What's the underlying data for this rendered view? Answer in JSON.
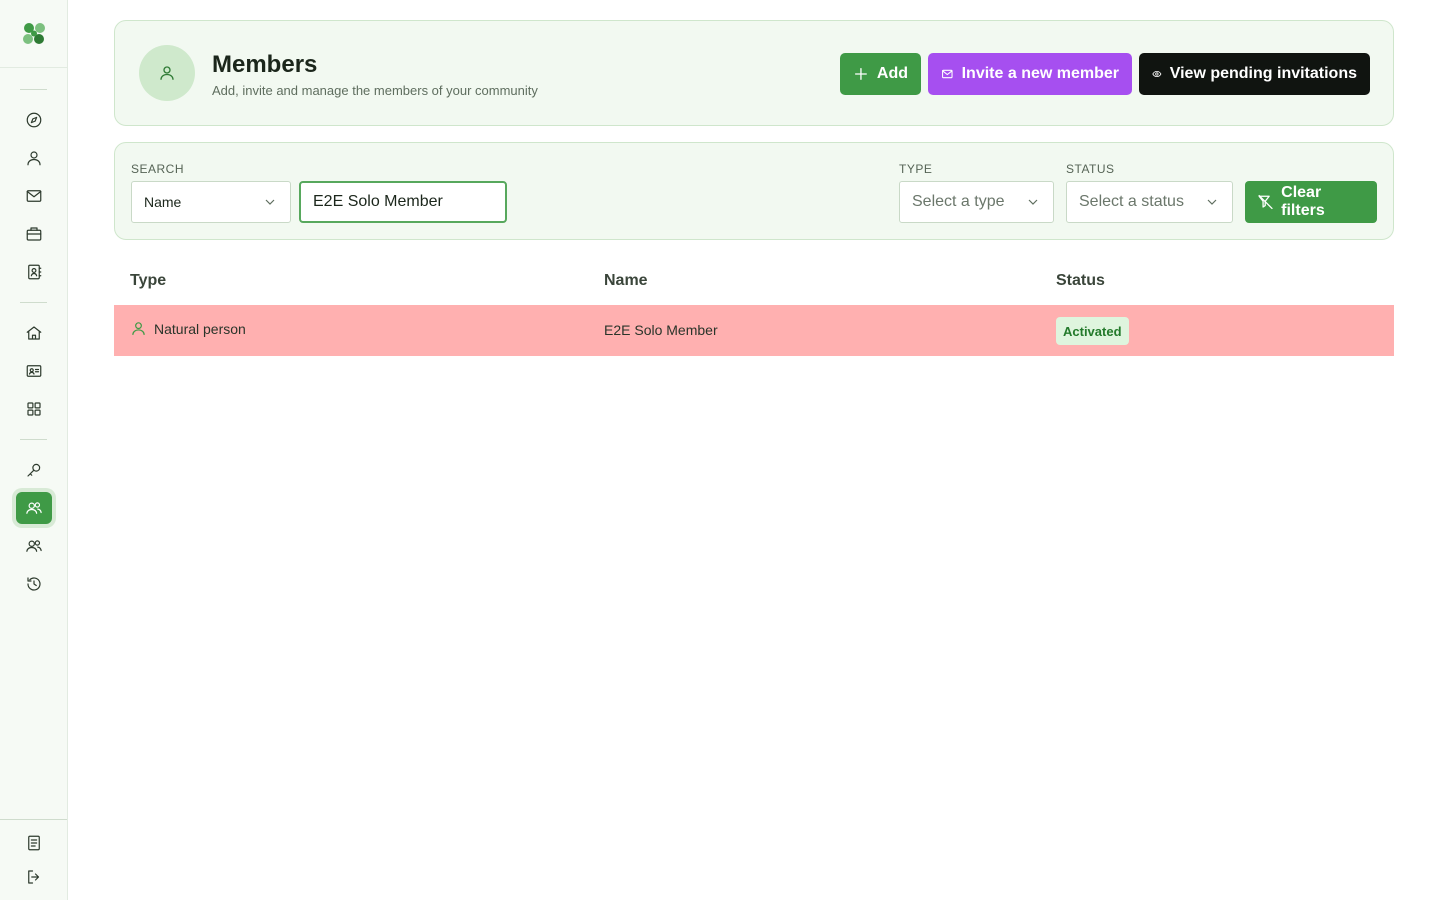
{
  "header": {
    "title": "Members",
    "subtitle": "Add, invite and manage the members of your community",
    "add_label": "Add",
    "invite_label": "Invite a new member",
    "pending_label": "View pending invitations"
  },
  "filters": {
    "search_label": "SEARCH",
    "search_field_selected": "Name",
    "search_value": "E2E Solo Member",
    "type_label": "TYPE",
    "type_placeholder": "Select a type",
    "status_label": "STATUS",
    "status_placeholder": "Select a status",
    "clear_label": "Clear filters"
  },
  "table": {
    "columns": [
      "Type",
      "Name",
      "Status"
    ],
    "rows": [
      {
        "type": "Natural person",
        "name": "E2E Solo Member",
        "status": "Activated"
      }
    ]
  },
  "sidebar": {
    "items": [
      "explore-icon",
      "user-icon",
      "mail-icon",
      "briefcase-icon",
      "contact-book-icon",
      "home-icon",
      "id-card-icon",
      "apps-grid-icon",
      "key-icon",
      "members-icon",
      "group-icon",
      "history-icon",
      "document-icon",
      "logout-icon"
    ],
    "active": "members-icon"
  },
  "colors": {
    "accent": "#3f9a46",
    "invite": "#a64ff0",
    "dark": "#101410",
    "row_highlight": "#ffb0b0",
    "badge_bg": "#dff5de"
  }
}
